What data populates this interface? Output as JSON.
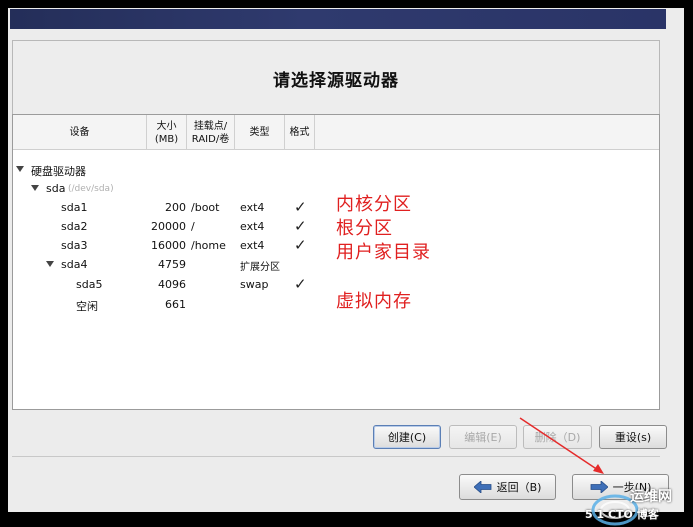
{
  "title": "请选择源驱动器",
  "columns": {
    "device": "设备",
    "size": "大小\n(MB)",
    "mount": "挂载点/\nRAID/卷",
    "type": "类型",
    "format": "格式"
  },
  "tree": {
    "hard_drives": "硬盘驱动器",
    "sda": "sda",
    "sda_path": "(/dev/sda)",
    "rows": [
      {
        "device": "sda1",
        "size": "200",
        "mount": "/boot",
        "type": "ext4",
        "format": "✓"
      },
      {
        "device": "sda2",
        "size": "20000",
        "mount": "/",
        "type": "ext4",
        "format": "✓"
      },
      {
        "device": "sda3",
        "size": "16000",
        "mount": "/home",
        "type": "ext4",
        "format": "✓"
      },
      {
        "device": "sda4",
        "size": "4759",
        "mount": "",
        "type": "扩展分区",
        "format": ""
      },
      {
        "device": "sda5",
        "size": "4096",
        "mount": "",
        "type": "swap",
        "format": "✓"
      },
      {
        "device": "空闲",
        "size": "661",
        "mount": "",
        "type": "",
        "format": ""
      }
    ]
  },
  "annotations": {
    "kernel": "内核分区",
    "root": "根分区",
    "home": "用户家目录",
    "swap": "虚拟内存"
  },
  "buttons": {
    "create": "创建(C)",
    "edit": "编辑(E)",
    "delete": "删除（D)",
    "reset": "重设(s)",
    "back": "返回（B)",
    "next": "一步(N)"
  },
  "watermark": {
    "line1": "运维网",
    "line2": "5 1 CTO 博客"
  },
  "colors": {
    "annotation": "#e02020",
    "topbar": "#2a3467",
    "arrow": "#e52b2b"
  }
}
